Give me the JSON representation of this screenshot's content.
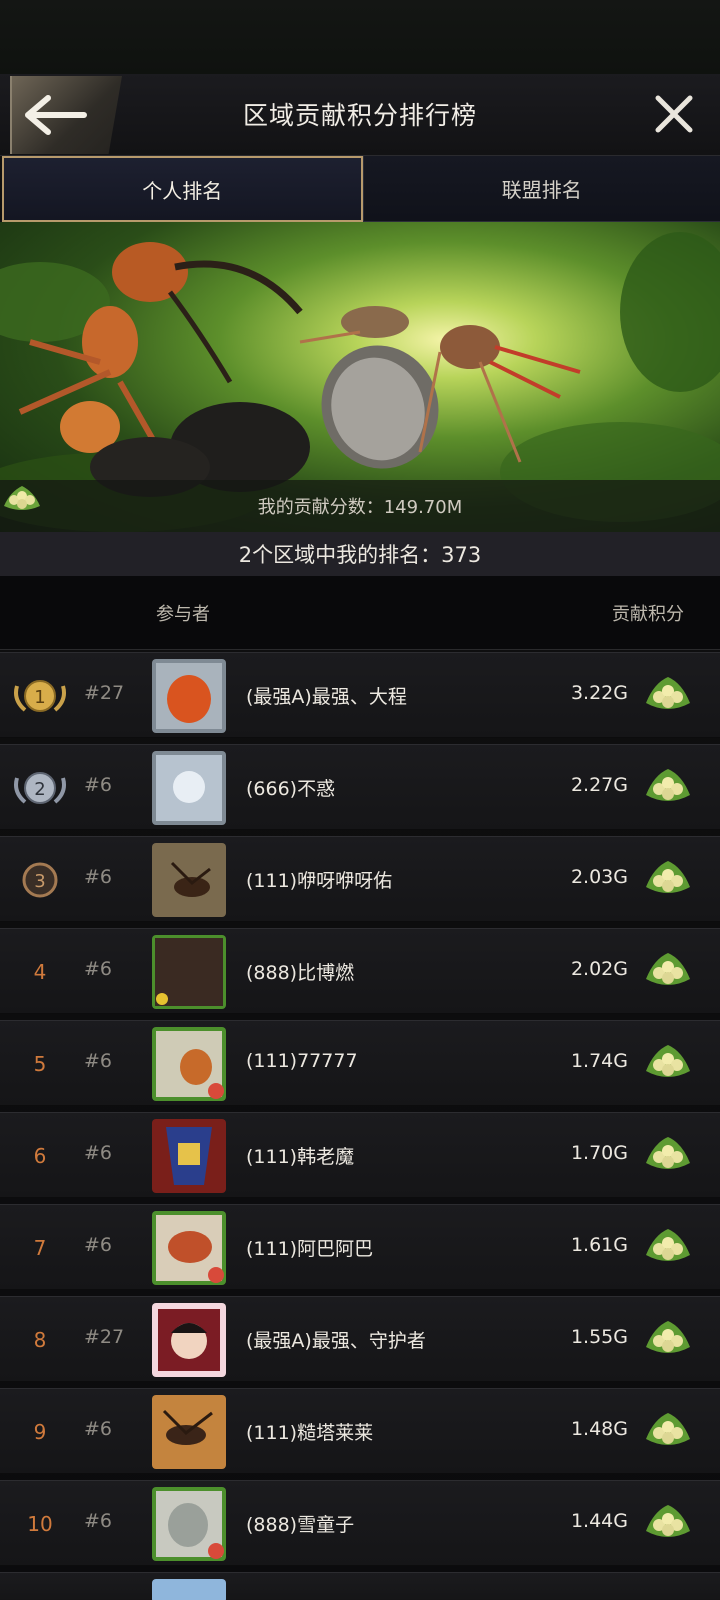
{
  "header": {
    "title": "区域贡献积分排行榜",
    "back_icon": "back-arrow-icon",
    "close_icon": "close-icon"
  },
  "tabs": [
    {
      "label": "个人排名",
      "active": true
    },
    {
      "label": "联盟排名",
      "active": false
    }
  ],
  "banner": {
    "my_score_label": "我的贡献分数：149.70M"
  },
  "region_rank": "2个区域中我的排名：373",
  "list_header": {
    "participant": "参与者",
    "score": "贡献积分"
  },
  "colors": {
    "gold": "#c9a14a",
    "rank_orange": "#d07a3c",
    "accent_border": "#b79a6c"
  },
  "rows": [
    {
      "rank": "1",
      "region": "#27",
      "name": "(最强A)最强、大程",
      "score": "3.22G",
      "rank_icon": "gold-medal-icon"
    },
    {
      "rank": "2",
      "region": "#6",
      "name": "(666)不惑",
      "score": "2.27G",
      "rank_icon": "silver-medal-icon"
    },
    {
      "rank": "3",
      "region": "#6",
      "name": "(111)咿呀咿呀佑",
      "score": "2.03G",
      "rank_icon": "bronze-medal-icon"
    },
    {
      "rank": "4",
      "region": "#6",
      "name": "(888)比博燃",
      "score": "2.02G"
    },
    {
      "rank": "5",
      "region": "#6",
      "name": "(111)77777",
      "score": "1.74G"
    },
    {
      "rank": "6",
      "region": "#6",
      "name": "(111)韩老魔",
      "score": "1.70G"
    },
    {
      "rank": "7",
      "region": "#6",
      "name": "(111)阿巴阿巴",
      "score": "1.61G"
    },
    {
      "rank": "8",
      "region": "#27",
      "name": "(最强A)最强、守护者",
      "score": "1.55G"
    },
    {
      "rank": "9",
      "region": "#6",
      "name": "(111)糙塔莱莱",
      "score": "1.48G"
    },
    {
      "rank": "10",
      "region": "#6",
      "name": "(888)雪童子",
      "score": "1.44G"
    }
  ]
}
